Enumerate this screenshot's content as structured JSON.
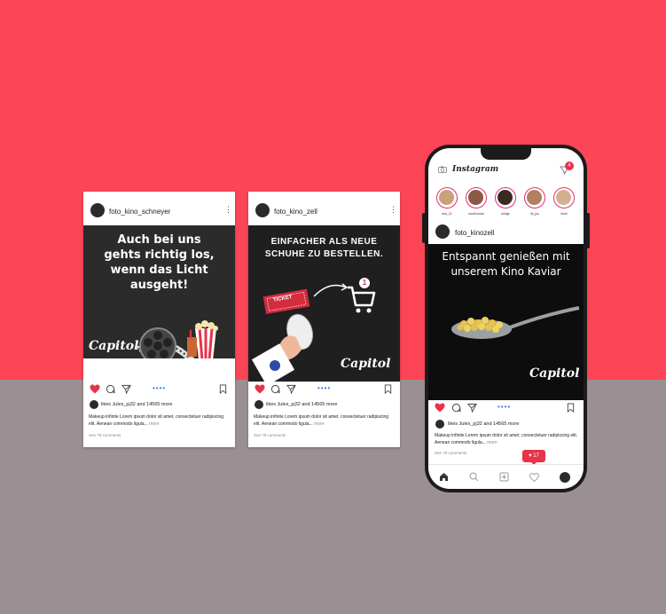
{
  "cards": [
    {
      "username": "foto_kino_schneyer",
      "headline": "Auch bei uns gehts richtig los, wenn das Licht ausgeht!",
      "likes": "likes Jules_pj32 and 14565 more",
      "caption": "Makeup infinite Lorem ipsum dolor sit amet, consectetuer radipiscing elit. Aenean commodo ligula...",
      "more": "more",
      "see_comments": "See 78 comments",
      "logo": "Capitol"
    },
    {
      "username": "foto_kino_zell",
      "headline": "EINFACHER ALS NEUE SCHUHE ZU BESTELLEN.",
      "ticket_label": "TICKET",
      "cart_badge": "1",
      "likes": "likes Jules_pj32 and 14565 more",
      "caption": "Makeup infinite Lorem ipsum dolor sit amet, consectetuer radipiscing elit. Aenean commodo ligula...",
      "more": "more",
      "see_comments": "See 78 comments",
      "logo": "Capitol"
    }
  ],
  "phone": {
    "app_name": "Instagram",
    "notification_badge": "4",
    "stories": [
      "ana_21",
      "tomthomas",
      "midge",
      "lili_jos",
      "kristi"
    ],
    "story_colors": [
      "#c9a27a",
      "#8a5a44",
      "#3a2a22",
      "#b08060",
      "#d4b090"
    ],
    "username": "foto_kinozell",
    "headline": "Entspannt genießen mit unserem Kino Kaviar",
    "likes": "likes Jules_pj32 and 14565 more",
    "caption": "Makeup infinite Lorem ipsum dolor sit amet, consectetuer radipiscing elit. Aenean commodo ligula...",
    "more": "more",
    "see_comments": "See 78 comments",
    "like_popup": "17",
    "logo": "Capitol"
  },
  "colors": {
    "top": "#fc4557",
    "bottom": "#9a9093",
    "heart": "#e8334a"
  }
}
